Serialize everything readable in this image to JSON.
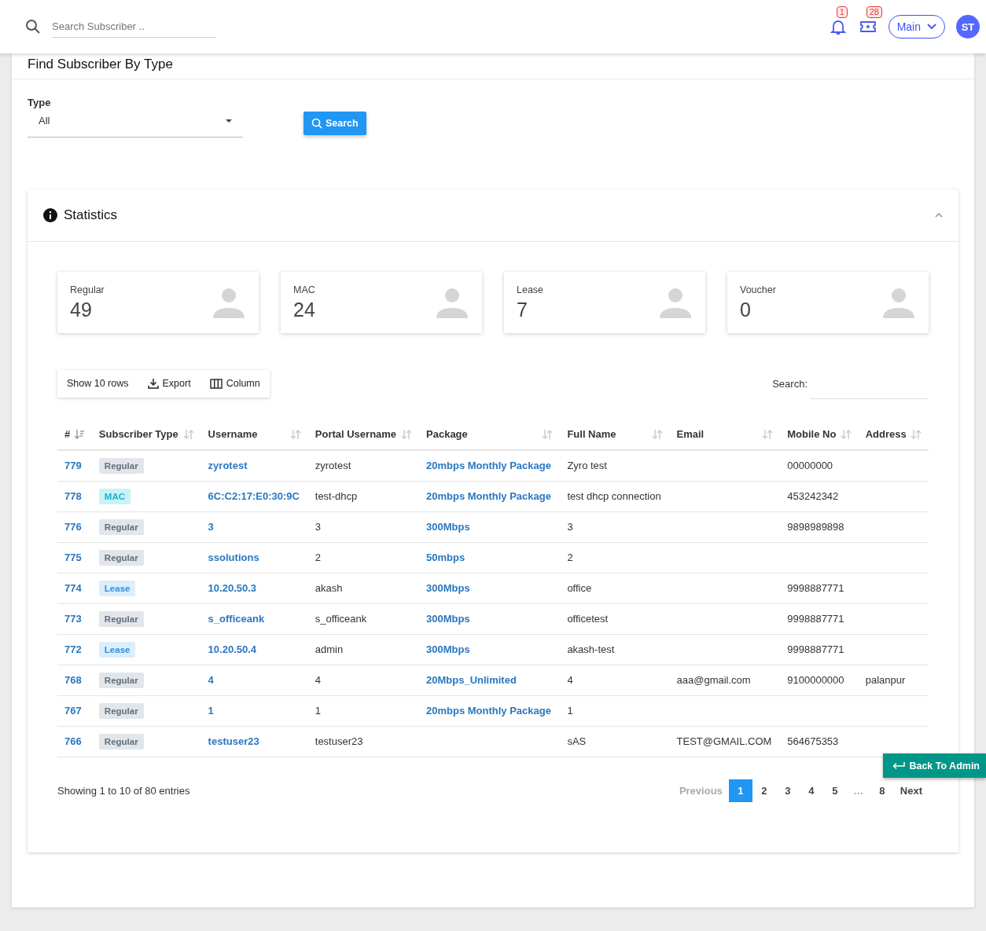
{
  "topbar": {
    "search": {
      "placeholder": "Search Subscriber .."
    },
    "notifications": {
      "count": "1"
    },
    "tickets": {
      "count": "28"
    },
    "menu": {
      "label": "Main"
    },
    "avatar": {
      "initials": "ST"
    }
  },
  "filter": {
    "title": "Find Subscriber By Type",
    "type_label": "Type",
    "type_value": "All",
    "search_button": "Search"
  },
  "statistics": {
    "title": "Statistics",
    "expanded": true,
    "cards": [
      {
        "label": "Regular",
        "value": "49"
      },
      {
        "label": "MAC",
        "value": "24"
      },
      {
        "label": "Lease",
        "value": "7"
      },
      {
        "label": "Voucher",
        "value": "0"
      }
    ]
  },
  "table_tools": {
    "show_rows": "Show 10 rows",
    "export": "Export",
    "column": "Column",
    "search_label": "Search:"
  },
  "table": {
    "columns": [
      "#",
      "Subscriber Type",
      "Username",
      "Portal Username",
      "Package",
      "Full Name",
      "Email",
      "Mobile No",
      "Address"
    ],
    "rows": [
      {
        "id": "779",
        "type": {
          "kind": "regular",
          "label": "Regular"
        },
        "username": "zyrotest",
        "portal_username": "zyrotest",
        "package": "20mbps Monthly Package",
        "full_name": "Zyro test",
        "email": "",
        "mobile": "00000000",
        "address": ""
      },
      {
        "id": "778",
        "type": {
          "kind": "mac",
          "label": "MAC"
        },
        "username": "6C:C2:17:E0:30:9C",
        "portal_username": "test-dhcp",
        "package": "20mbps Monthly Package",
        "full_name": "test dhcp connection",
        "email": "",
        "mobile": "453242342",
        "address": ""
      },
      {
        "id": "776",
        "type": {
          "kind": "regular",
          "label": "Regular"
        },
        "username": "3",
        "portal_username": "3",
        "package": "300Mbps",
        "full_name": "3",
        "email": "",
        "mobile": "9898989898",
        "address": ""
      },
      {
        "id": "775",
        "type": {
          "kind": "regular",
          "label": "Regular"
        },
        "username": "ssolutions",
        "portal_username": "2",
        "package": "50mbps",
        "full_name": "2",
        "email": "",
        "mobile": "",
        "address": ""
      },
      {
        "id": "774",
        "type": {
          "kind": "lease",
          "label": "Lease"
        },
        "username": "10.20.50.3",
        "portal_username": "akash",
        "package": "300Mbps",
        "full_name": "office",
        "email": "",
        "mobile": "9998887771",
        "address": ""
      },
      {
        "id": "773",
        "type": {
          "kind": "regular",
          "label": "Regular"
        },
        "username": "s_officeank",
        "portal_username": "s_officeank",
        "package": "300Mbps",
        "full_name": "officetest",
        "email": "",
        "mobile": "9998887771",
        "address": ""
      },
      {
        "id": "772",
        "type": {
          "kind": "lease",
          "label": "Lease"
        },
        "username": "10.20.50.4",
        "portal_username": "admin",
        "package": "300Mbps",
        "full_name": "akash-test",
        "email": "",
        "mobile": "9998887771",
        "address": ""
      },
      {
        "id": "768",
        "type": {
          "kind": "regular",
          "label": "Regular"
        },
        "username": "4",
        "portal_username": "4",
        "package": "20Mbps_Unlimited",
        "full_name": "4",
        "email": "aaa@gmail.com",
        "mobile": "9100000000",
        "address": "palanpur"
      },
      {
        "id": "767",
        "type": {
          "kind": "regular",
          "label": "Regular"
        },
        "username": "1",
        "portal_username": "1",
        "package": "20mbps Monthly Package",
        "full_name": "1",
        "email": "",
        "mobile": "",
        "address": ""
      },
      {
        "id": "766",
        "type": {
          "kind": "regular",
          "label": "Regular"
        },
        "username": "testuser23",
        "portal_username": "testuser23",
        "package": "",
        "full_name": "sAS",
        "email": "TEST@GMAIL.COM",
        "mobile": "564675353",
        "address": ""
      }
    ]
  },
  "footer": {
    "info": "Showing 1 to 10 of 80 entries",
    "pages": [
      {
        "label": "Previous",
        "selected": false,
        "disabled": true
      },
      {
        "label": "1",
        "selected": true,
        "disabled": false
      },
      {
        "label": "2",
        "selected": false,
        "disabled": false
      },
      {
        "label": "3",
        "selected": false,
        "disabled": false
      },
      {
        "label": "4",
        "selected": false,
        "disabled": false
      },
      {
        "label": "5",
        "selected": false,
        "disabled": false
      },
      {
        "label": "…",
        "selected": false,
        "disabled": true
      },
      {
        "label": "8",
        "selected": false,
        "disabled": false
      },
      {
        "label": "Next",
        "selected": false,
        "disabled": false
      }
    ]
  },
  "back_button": "Back To Admin"
}
